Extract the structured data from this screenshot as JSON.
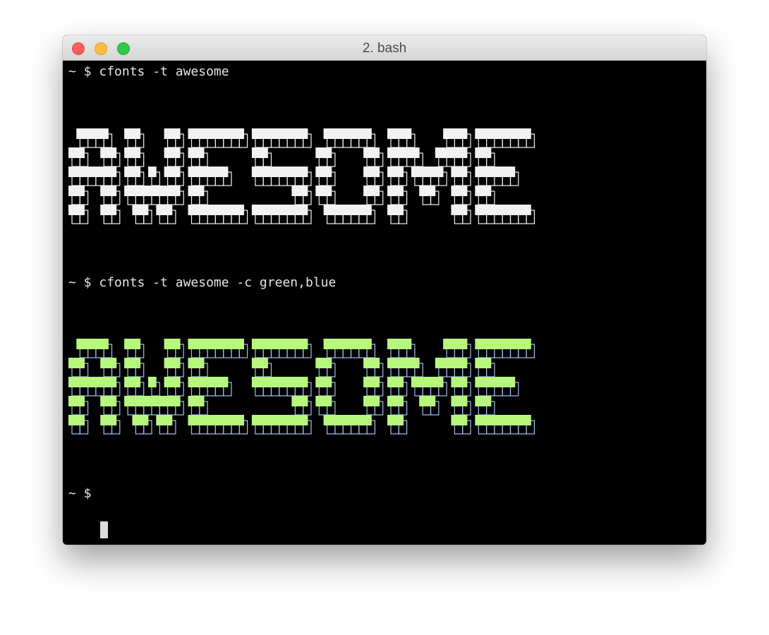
{
  "window": {
    "title": "2. bash",
    "buttons": [
      "close",
      "minimize",
      "zoom"
    ]
  },
  "terminal": {
    "prompt": "~ $",
    "commands": [
      {
        "prompt": "~ $",
        "text": "cfonts -t awesome"
      },
      {
        "prompt": "~ $",
        "text": "cfonts -t awesome -c green,blue"
      }
    ],
    "banners": [
      {
        "text": "AWESOME",
        "fill": "#f2f2f2",
        "outline": "#f2f2f2"
      },
      {
        "text": "AWESOME",
        "fill": "#b7f77e",
        "outline": "#9ec3f0"
      }
    ],
    "final_prompt": "~ $"
  }
}
